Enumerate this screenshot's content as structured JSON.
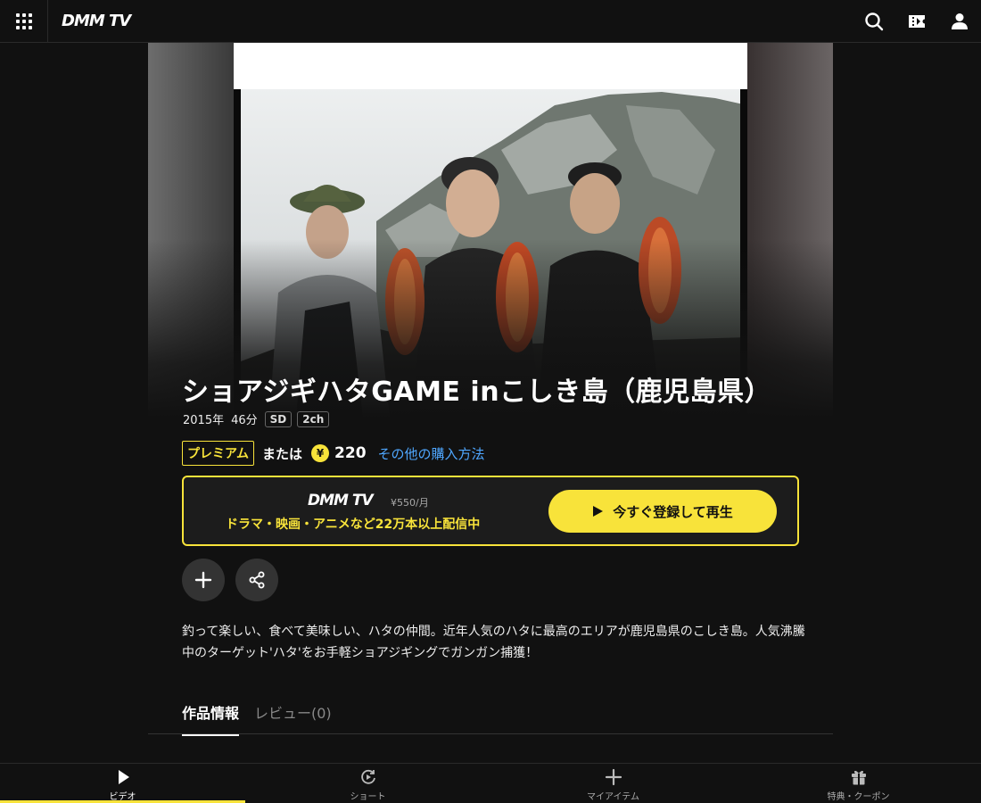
{
  "header": {
    "logo": "DMM TV",
    "icons": [
      "search-icon",
      "ticket-icon",
      "user-icon"
    ]
  },
  "content": {
    "title": "ショアジギハタGAME inこしき島（鹿児島県）",
    "year": "2015年",
    "duration": "46分",
    "badges": [
      "SD",
      "2ch"
    ],
    "premium_label": "プレミアム",
    "or_label": "または",
    "yen_symbol": "¥",
    "price": "220",
    "other_purchase_link": "その他の購入方法",
    "description": "釣って楽しい、食べて美味しい、ハタの仲間。近年人気のハタに最高のエリアが鹿児島県のこしき島。人気沸騰中のターゲット'ハタ'をお手軽ショアジギングでガンガン捕獲！"
  },
  "promo": {
    "logo": "DMM TV",
    "monthly_price": "¥550/月",
    "tagline": "ドラマ・映画・アニメなど22万本以上配信中",
    "cta_label": "今すぐ登録して再生"
  },
  "tabs": [
    {
      "label": "作品情報",
      "active": true
    },
    {
      "label": "レビュー(0)",
      "active": false
    }
  ],
  "bottom_nav": [
    {
      "label": "ビデオ",
      "icon": "play-icon",
      "active": true
    },
    {
      "label": "ショート",
      "icon": "short-icon",
      "active": false
    },
    {
      "label": "マイアイテム",
      "icon": "plus-icon",
      "active": false
    },
    {
      "label": "特典・クーポン",
      "icon": "gift-icon",
      "active": false
    }
  ],
  "colors": {
    "accent": "#f8e33a",
    "link": "#4fa7ff",
    "background": "#111111"
  }
}
